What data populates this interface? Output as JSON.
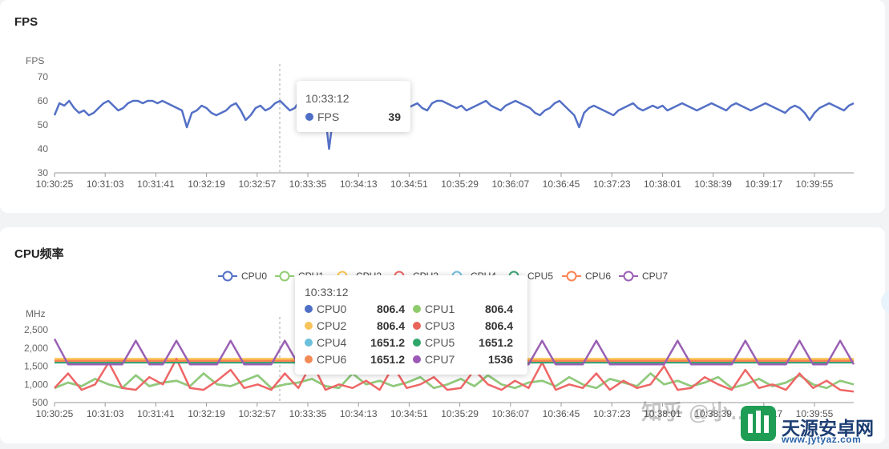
{
  "fps_panel": {
    "title": "FPS",
    "tooltip": {
      "time": "10:33:12",
      "series": "FPS",
      "value": "39"
    }
  },
  "cpu_panel": {
    "title": "CPU频率",
    "tooltip": {
      "time": "10:33:12",
      "rows": [
        {
          "name": "CPU0",
          "value": "806.4",
          "color": "#4e6fc5"
        },
        {
          "name": "CPU1",
          "value": "806.4",
          "color": "#8fcb6b"
        },
        {
          "name": "CPU2",
          "value": "806.4",
          "color": "#f7c35a"
        },
        {
          "name": "CPU3",
          "value": "806.4",
          "color": "#e8645a"
        },
        {
          "name": "CPU4",
          "value": "1651.2",
          "color": "#6cc0dc"
        },
        {
          "name": "CPU5",
          "value": "1651.2",
          "color": "#2ea66b"
        },
        {
          "name": "CPU6",
          "value": "1651.2",
          "color": "#f28a56"
        },
        {
          "name": "CPU7",
          "value": "1536",
          "color": "#9b59b6"
        }
      ]
    }
  },
  "watermarks": {
    "zhihu": "知乎 @小…",
    "site_name": "天源安卓网",
    "site_url": "www.jytyaz.com"
  },
  "chart_data": [
    {
      "type": "line",
      "title": "FPS",
      "ylabel": "FPS",
      "ylim": [
        30,
        70
      ],
      "yticks": [
        "30",
        "40",
        "50",
        "60",
        "70"
      ],
      "xticks": [
        "10:30:25",
        "10:31:03",
        "10:31:41",
        "10:32:19",
        "10:32:57",
        "10:33:35",
        "10:34:13",
        "10:34:51",
        "10:35:29",
        "10:36:07",
        "10:36:45",
        "10:37:23",
        "10:38:01",
        "10:38:39",
        "10:39:17",
        "10:39:55"
      ],
      "grid": false,
      "series": [
        {
          "name": "FPS",
          "color": "#5470c6",
          "values": [
            54,
            59,
            58,
            60,
            57,
            55,
            56,
            54,
            55,
            57,
            59,
            60,
            58,
            56,
            57,
            59,
            60,
            60,
            59,
            60,
            60,
            59,
            60,
            59,
            58,
            57,
            56,
            49,
            55,
            56,
            58,
            57,
            55,
            54,
            55,
            56,
            58,
            59,
            56,
            52,
            54,
            57,
            58,
            56,
            57,
            59,
            60,
            58,
            56,
            57,
            60,
            60,
            58,
            59,
            57,
            58,
            40,
            56,
            57,
            58,
            59,
            57,
            56,
            58,
            56,
            55,
            56,
            57,
            58,
            56,
            55,
            54,
            57,
            58,
            59,
            57,
            56,
            59,
            60,
            60,
            59,
            58,
            57,
            58,
            56,
            57,
            58,
            59,
            60,
            58,
            57,
            56,
            58,
            59,
            60,
            59,
            58,
            57,
            55,
            54,
            56,
            57,
            59,
            60,
            58,
            56,
            54,
            49,
            55,
            57,
            58,
            57,
            56,
            55,
            54,
            56,
            57,
            58,
            59,
            57,
            56,
            57,
            58,
            57,
            58,
            56,
            57,
            58,
            59,
            58,
            57,
            56,
            57,
            58,
            59,
            58,
            57,
            56,
            58,
            59,
            58,
            57,
            56,
            57,
            58,
            59,
            58,
            57,
            56,
            55,
            57,
            58,
            57,
            55,
            52,
            55,
            57,
            58,
            59,
            58,
            57,
            56,
            58,
            59
          ]
        }
      ]
    },
    {
      "type": "line",
      "title": "CPU频率",
      "ylabel": "MHz",
      "ylim": [
        500,
        2500
      ],
      "yticks": [
        "500",
        "1,000",
        "1,500",
        "2,000",
        "2,500"
      ],
      "xticks": [
        "10:30:25",
        "10:31:03",
        "10:31:41",
        "10:32:19",
        "10:32:57",
        "10:33:35",
        "10:34:13",
        "10:34:51",
        "10:35:29",
        "10:36:07",
        "10:36:45",
        "10:37:23",
        "10:38:01",
        "10:38:39",
        "10:39:17",
        "10:39:55"
      ],
      "legend": [
        "CPU0",
        "CPU1",
        "CPU2",
        "CPU3",
        "CPU4",
        "CPU5",
        "CPU6",
        "CPU7"
      ],
      "legend_position": "top",
      "grid": false,
      "series": [
        {
          "name": "CPU0",
          "color": "#5470c6",
          "values": [
            900,
            1050,
            950,
            1150,
            1000,
            900,
            1250,
            950,
            1050,
            1100,
            950,
            1300,
            1000,
            950,
            1100,
            1250,
            900,
            1000,
            1050,
            1150,
            950,
            900,
            1300,
            1000,
            1100,
            950,
            1050,
            1200,
            900,
            1000,
            1150,
            950,
            1250,
            1000,
            900,
            1050,
            1100,
            950,
            1200,
            1000,
            900,
            1150,
            1050,
            950,
            1300,
            1000,
            1100,
            950,
            1050,
            1200,
            900,
            1000,
            1150,
            950,
            1050,
            1250,
            1000,
            900,
            1100,
            1000
          ]
        },
        {
          "name": "CPU1",
          "color": "#91cc75",
          "values": [
            900,
            1050,
            950,
            1150,
            1000,
            900,
            1250,
            950,
            1050,
            1100,
            950,
            1300,
            1000,
            950,
            1100,
            1250,
            900,
            1000,
            1050,
            1150,
            950,
            900,
            1300,
            1000,
            1100,
            950,
            1050,
            1200,
            900,
            1000,
            1150,
            950,
            1250,
            1000,
            900,
            1050,
            1100,
            950,
            1200,
            1000,
            900,
            1150,
            1050,
            950,
            1300,
            1000,
            1100,
            950,
            1050,
            1200,
            900,
            1000,
            1150,
            950,
            1050,
            1250,
            1000,
            900,
            1100,
            1000
          ]
        },
        {
          "name": "CPU2",
          "color": "#fac858",
          "values": [
            1700,
            1700,
            1700,
            1700,
            1700,
            1700,
            1700,
            1700,
            1700,
            1700,
            1700,
            1700,
            1700,
            1700,
            1700,
            1700,
            1700,
            1700,
            1700,
            1700,
            1700,
            1700,
            1700,
            1700,
            1700,
            1700,
            1700,
            1700,
            1700,
            1700,
            1700,
            1700,
            1700,
            1700,
            1700,
            1700,
            1700,
            1700,
            1700,
            1700,
            1700,
            1700,
            1700,
            1700,
            1700,
            1700,
            1700,
            1700,
            1700,
            1700,
            1700,
            1700,
            1700,
            1700,
            1700,
            1700,
            1700,
            1700,
            1700,
            1700
          ]
        },
        {
          "name": "CPU3",
          "color": "#ee6666",
          "values": [
            900,
            1300,
            850,
            1000,
            1600,
            900,
            850,
            1200,
            1000,
            1700,
            900,
            850,
            1100,
            1400,
            900,
            1000,
            850,
            1300,
            900,
            1600,
            850,
            1000,
            900,
            1100,
            850,
            1500,
            900,
            1000,
            1200,
            850,
            900,
            1400,
            1000,
            850,
            1100,
            900,
            1600,
            850,
            1000,
            900,
            1300,
            850,
            1100,
            900,
            1000,
            1500,
            850,
            900,
            1200,
            1000,
            850,
            1400,
            900,
            1000,
            850,
            1300,
            900,
            1100,
            850,
            800
          ]
        },
        {
          "name": "CPU4",
          "color": "#73c0de",
          "values": [
            1600,
            1600,
            1600,
            1600,
            1600,
            1600,
            1600,
            1600,
            1600,
            1600,
            1600,
            1600,
            1600,
            1600,
            1600,
            1600,
            1600,
            1600,
            1600,
            1600,
            1600,
            1600,
            1600,
            1600,
            1600,
            1600,
            1600,
            1600,
            1600,
            1600,
            1600,
            1600,
            1600,
            1600,
            1600,
            1600,
            1600,
            1600,
            1600,
            1600,
            1600,
            1600,
            1600,
            1600,
            1600,
            1600,
            1600,
            1600,
            1600,
            1600,
            1600,
            1600,
            1600,
            1600,
            1600,
            1600,
            1600,
            1600,
            1600,
            1600
          ]
        },
        {
          "name": "CPU5",
          "color": "#3ba272",
          "values": [
            1600,
            1600,
            1600,
            1600,
            1600,
            1600,
            1600,
            1600,
            1600,
            1600,
            1600,
            1600,
            1600,
            1600,
            1600,
            1600,
            1600,
            1600,
            1600,
            1600,
            1600,
            1600,
            1600,
            1600,
            1600,
            1600,
            1600,
            1600,
            1600,
            1600,
            1600,
            1600,
            1600,
            1600,
            1600,
            1600,
            1600,
            1600,
            1600,
            1600,
            1600,
            1600,
            1600,
            1600,
            1600,
            1600,
            1600,
            1600,
            1600,
            1600,
            1600,
            1600,
            1600,
            1600,
            1600,
            1600,
            1600,
            1600,
            1600,
            1600
          ]
        },
        {
          "name": "CPU6",
          "color": "#fc8452",
          "values": [
            1650,
            1650,
            1650,
            1650,
            1650,
            1650,
            1650,
            1650,
            1650,
            1650,
            1650,
            1650,
            1650,
            1650,
            1650,
            1650,
            1650,
            1650,
            1650,
            1650,
            1650,
            1650,
            1650,
            1650,
            1650,
            1650,
            1650,
            1650,
            1650,
            1650,
            1650,
            1650,
            1650,
            1650,
            1650,
            1650,
            1650,
            1650,
            1650,
            1650,
            1650,
            1650,
            1650,
            1650,
            1650,
            1650,
            1650,
            1650,
            1650,
            1650,
            1650,
            1650,
            1650,
            1650,
            1650,
            1650,
            1650,
            1650,
            1650,
            1650
          ]
        },
        {
          "name": "CPU7",
          "color": "#9a60b4",
          "values": [
            2250,
            1550,
            1550,
            1550,
            1550,
            1550,
            2200,
            1550,
            1550,
            2200,
            1550,
            1550,
            1550,
            2200,
            1550,
            1550,
            1550,
            2200,
            1550,
            1550,
            1550,
            1550,
            2200,
            1550,
            1550,
            1550,
            1550,
            1550,
            1550,
            1550,
            2200,
            1550,
            1550,
            1550,
            1550,
            1550,
            2200,
            1550,
            1550,
            1550,
            2200,
            1550,
            1550,
            1550,
            1550,
            1550,
            2200,
            1550,
            1550,
            1550,
            1550,
            2200,
            1550,
            1550,
            1550,
            2200,
            1550,
            1550,
            2200,
            1550
          ]
        }
      ]
    }
  ]
}
